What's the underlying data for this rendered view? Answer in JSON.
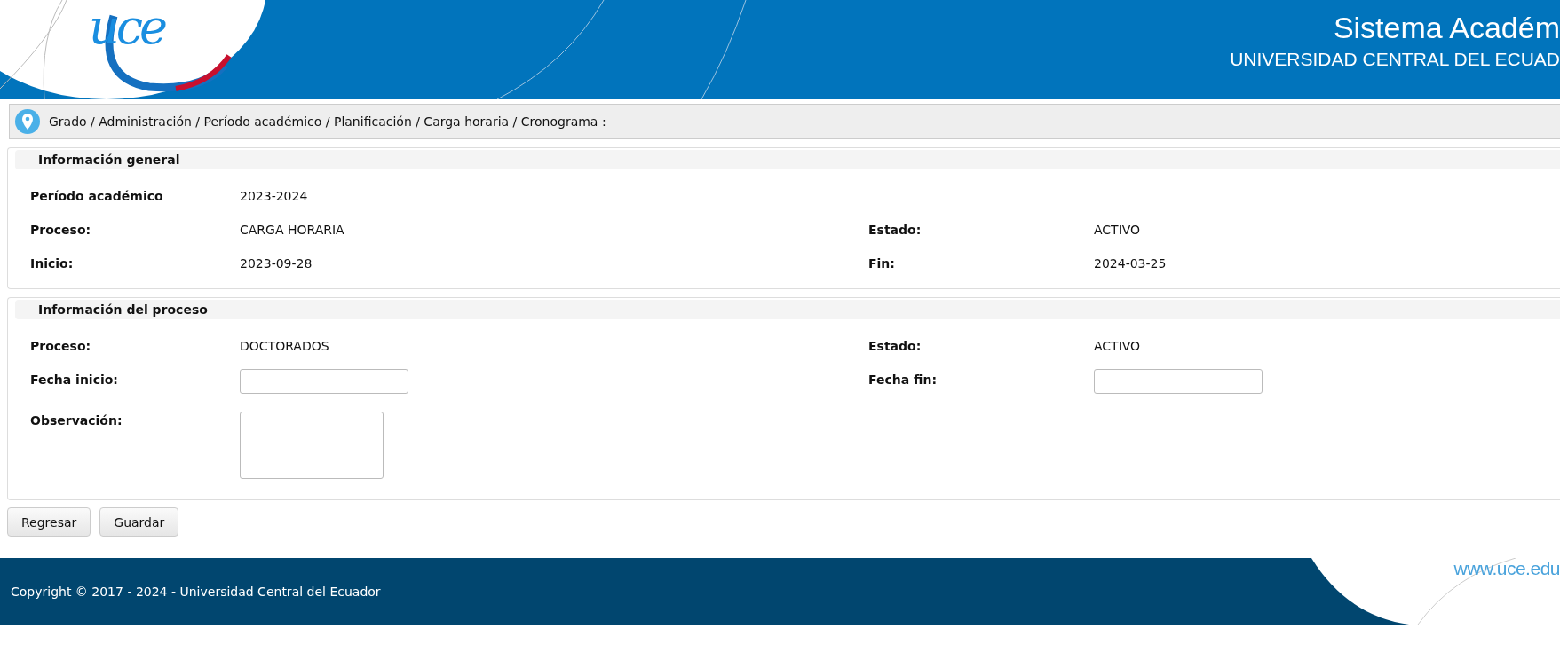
{
  "header": {
    "logo_text": "uce",
    "title": "Sistema Académ",
    "subtitle": "UNIVERSIDAD CENTRAL DEL ECUAD"
  },
  "breadcrumb": "Grado / Administración / Período académico / Planificación / Carga horaria / Cronograma :",
  "sections": [
    {
      "title": "Información general",
      "rows": [
        [
          {
            "label": "Período académico",
            "kind": "text",
            "value": "2023-2024"
          }
        ],
        [
          {
            "label": "Proceso:",
            "kind": "text",
            "value": "CARGA HORARIA"
          },
          {
            "label": "Estado:",
            "kind": "text",
            "value": "ACTIVO"
          }
        ],
        [
          {
            "label": "Inicio:",
            "kind": "text",
            "value": "2023-09-28"
          },
          {
            "label": "Fin:",
            "kind": "text",
            "value": "2024-03-25"
          }
        ]
      ]
    },
    {
      "title": "Información del proceso",
      "rows": [
        [
          {
            "label": "Proceso:",
            "kind": "text",
            "value": "DOCTORADOS"
          },
          {
            "label": "Estado:",
            "kind": "text",
            "value": "ACTIVO"
          }
        ],
        [
          {
            "label": "Fecha inicio:",
            "kind": "input"
          },
          {
            "label": "Fecha fin:",
            "kind": "input"
          }
        ],
        [
          {
            "label": "Observación:",
            "kind": "textarea"
          }
        ]
      ]
    }
  ],
  "buttons": [
    "Regresar",
    "Guardar"
  ],
  "footer": {
    "copyright": "Copyright © 2017 - 2024 - Universidad Central del Ecuador",
    "url": "www.uce.edu"
  }
}
